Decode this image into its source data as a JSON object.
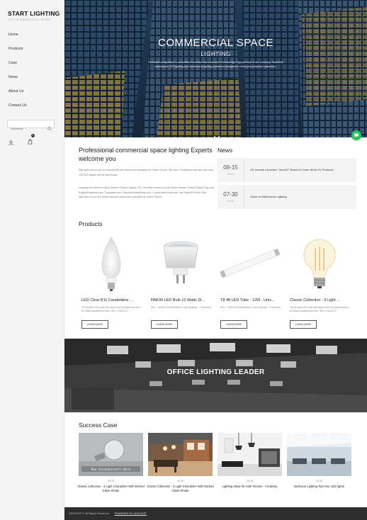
{
  "brand": {
    "title": "START LIGHTING",
    "subtitle": "LIFE IS A BEAUTIFUL SPORT"
  },
  "nav": [
    "Home",
    "Products",
    "Case",
    "News",
    "About Us",
    "Contact Us"
  ],
  "search": {
    "placeholder": "Keywords"
  },
  "cart": {
    "count": "0"
  },
  "hero": {
    "title": "COMMERCIAL SPACE",
    "subtitle": "LIGHTING",
    "description": "Technical cooperation is committed to create new concepts to encourage improvement of our company. Industrial warehouse LED lighting and commercial lighting system is designed to meet your business objectives."
  },
  "about": {
    "title": "Professional commercial space lighting Experts welcome you",
    "p1": "Star light.com is one of 8 stores that are owned and operated by Online Stores. We have 75 staff and operate from over 130,000 square feet of warehouse.",
    "p2": "shipping and offices in New Stanton PA and Sparks, NV. Our other stores include Online Stores: United-States-Flag.com, EnglishFeatstore.com, Toysplash.com, DiscountSafetyGear.com, ConstructionGear.com, and SafetyGirl.com.Star light.com is one of 8 stores that are owned and operated by Online Stores."
  },
  "news": {
    "heading": "News",
    "items": [
      {
        "day": "08-15",
        "year": "2018",
        "text": "US Innotek Launches \"InnoUV\" Brand to Cover All its UV Products"
      },
      {
        "day": "07-30",
        "year": "2018",
        "text": "Guide to Warehouse Lighting"
      }
    ]
  },
  "products": {
    "heading": "Products",
    "items": [
      {
        "name": "LED Clear B11 Candelabra …",
        "desc": "The 8 Watt LED emits the same level of brightness as a 60 Watt incandescent bulb. SKU: LEDLICH…",
        "button": "LEARN MORE"
      },
      {
        "name": "PAR30 LED Bulb 10 Watts Di…",
        "desc": "SKU : LEDLICH1000036A1e Case Quantity : 1 Warranty : …",
        "button": "LEARN MORE"
      },
      {
        "name": "T8 4ft LED Tube - 12W - Univ…",
        "desc": "SKU : LEDLICH1000036B1e Case Quantity : 1 Warranty : …",
        "button": "LEARN MORE"
      },
      {
        "name": "Classic Collection - 3 Light …",
        "desc": "The 8 Watt LED emits the same level of brightness as a 60 Watt incandescent bulb. SKU: LEDLICH…",
        "button": "LEARN MORE"
      }
    ]
  },
  "banner": {
    "text": "OFFICE LIGHTING LEADER"
  },
  "cases": {
    "heading": "Success Case",
    "overlay": "Now Incandescents Work",
    "items": [
      {
        "date": "Jul 30",
        "name": "Classic Collection - 3 Light Chandelier With Etched Glass Shade"
      },
      {
        "date": "Jul 30",
        "name": "Classic Collection - 3 Light Chandelier With Etched Glass Shade"
      },
      {
        "date": "Jul 30",
        "name": "Lighting Ideas for Kids' Rooms - Creativity"
      },
      {
        "date": "Jul 30",
        "name": "Bedroom Lighting Tips-Use LED lights"
      }
    ]
  },
  "footer": {
    "copyright": "UEESHOP © All Rights Reserved.",
    "powered": "POWERED BY UEESHOP"
  },
  "colors": {
    "chat": "#22c55e",
    "footer": "#2d2d2d",
    "sidebar": "#f4f4f4"
  }
}
